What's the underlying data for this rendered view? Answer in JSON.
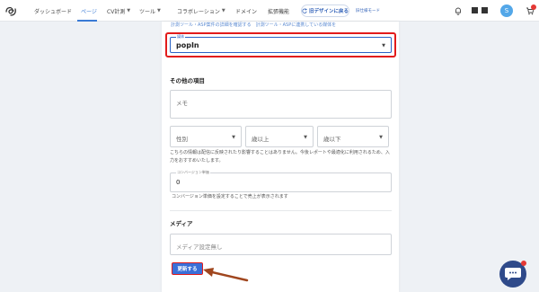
{
  "nav": {
    "items": [
      "ダッシュボード",
      "ページ",
      "CV計測",
      "ツール",
      "コラボレーション",
      "ドメイン",
      "拡張機能"
    ],
    "active_index": 1,
    "promo_label": "旧デザインに戻る",
    "legacy_label": "旧仕様モード",
    "avatar_initial": "S"
  },
  "form": {
    "help_links": "計測ツール・ASP案件の詳細を確認する　計測ツール・ASPに連携している媒体を",
    "media": {
      "label": "媒体",
      "value": "popIn"
    },
    "other_section_title": "その他の項目",
    "memo_placeholder": "メモ",
    "gender_placeholder": "性別",
    "age_min_placeholder": "歳以上",
    "age_max_placeholder": "歳以下",
    "note_text": "こちらの情報は配信に反映されたり影響することはありません。今後レポートや最適化に利用されるため、入力をおすすめいたします。",
    "cv_unit_price": {
      "label": "コンバージョン単価",
      "value": "0"
    },
    "cv_unit_note": "コンバージョン単価を設定することで売上が表示されます",
    "media_section_title": "メディア",
    "media_setting_placeholder": "メディア設定無し",
    "update_button": "更新する"
  },
  "colors": {
    "accent": "#3a6fd8",
    "highlight": "#e21b1b",
    "arrow": "#a0461e"
  }
}
